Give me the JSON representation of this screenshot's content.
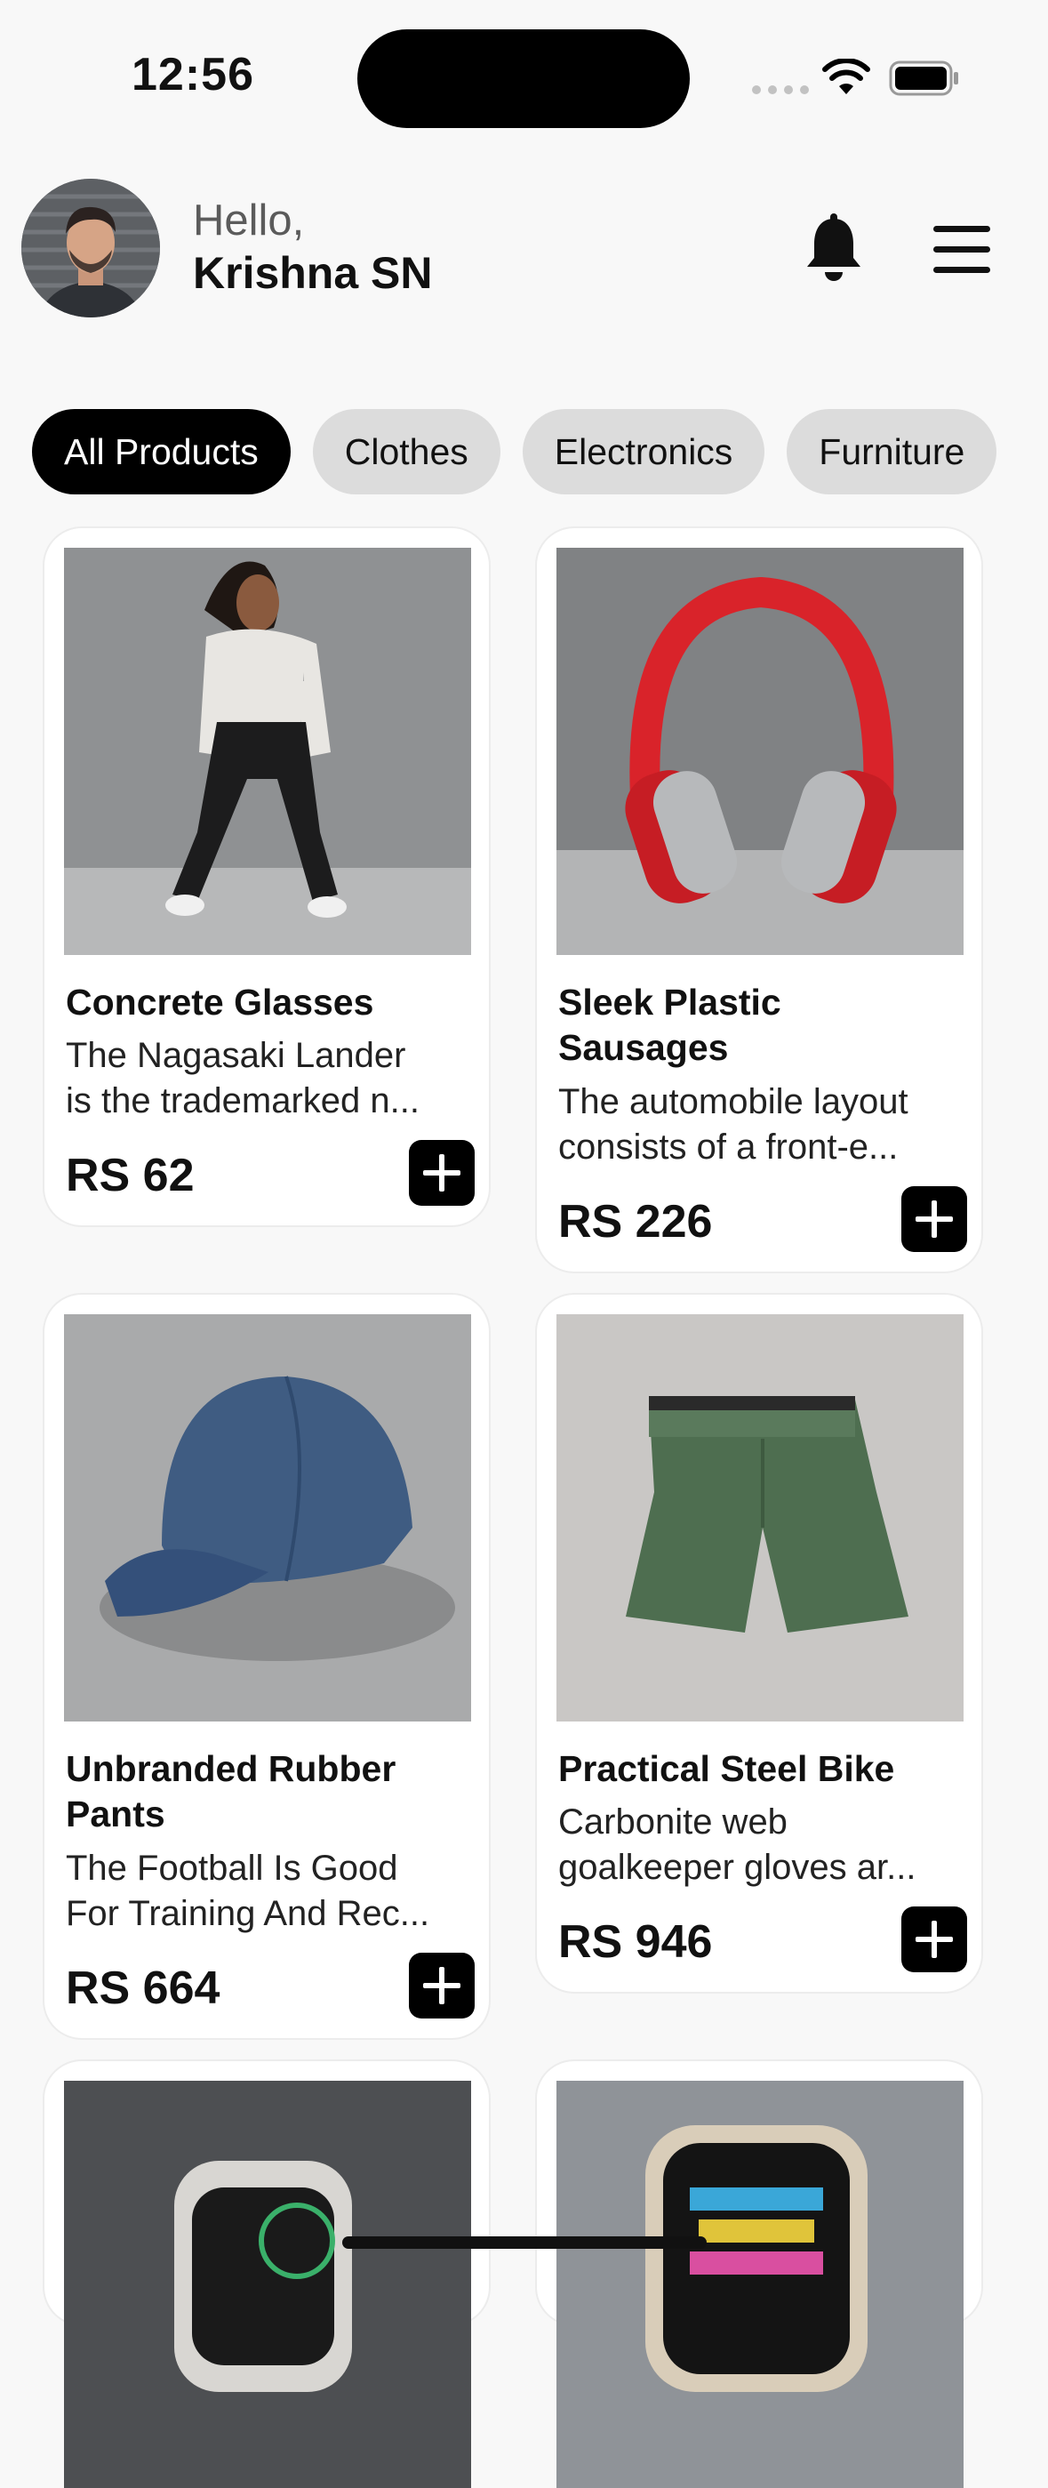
{
  "status": {
    "time": "12:56"
  },
  "header": {
    "greeting": "Hello,",
    "user_name": "Krishna SN"
  },
  "categories": [
    {
      "label": "All Products",
      "active": true
    },
    {
      "label": "Clothes",
      "active": false
    },
    {
      "label": "Electronics",
      "active": false
    },
    {
      "label": "Furniture",
      "active": false
    }
  ],
  "products": [
    {
      "title": "Concrete Glasses",
      "description": [
        "The Nagasaki Lander",
        "is the trademarked n..."
      ],
      "price": "RS 62",
      "image": "woman-joggers-photo"
    },
    {
      "title": "Sleek Plastic Sausages",
      "description": [
        "The automobile layout",
        "consists of a front-e..."
      ],
      "price": "RS 226",
      "image": "red-headphones-photo"
    },
    {
      "title": "Unbranded Rubber Pants",
      "description": [
        "The Football Is Good",
        "For Training And Rec..."
      ],
      "price": "RS 664",
      "image": "blue-cap-photo"
    },
    {
      "title": "Practical Steel Bike",
      "description": [
        "Carbonite web",
        "goalkeeper gloves ar..."
      ],
      "price": "RS 946",
      "image": "green-shorts-photo"
    },
    {
      "title": "",
      "description": [],
      "price": "",
      "image": "smartwatch-photo"
    },
    {
      "title": "",
      "description": [],
      "price": "",
      "image": "smartwatch-colorful-photo"
    }
  ],
  "colors": {
    "background": "#f8f8f8",
    "chip_active": "#000000",
    "chip_inactive": "#dcdcdc",
    "card": "#ffffff"
  }
}
